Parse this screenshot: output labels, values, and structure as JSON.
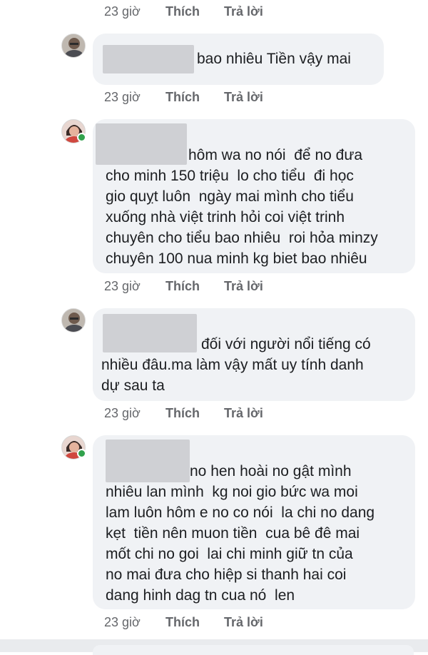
{
  "actions": {
    "time": "23 giờ",
    "like": "Thích",
    "reply": "Trả lời"
  },
  "comments": [
    {
      "avatar": "avatar-woman-glasses",
      "lines": [
        "bao nhiêu Tiền vậy mai"
      ]
    },
    {
      "avatar": "avatar-woman-online",
      "online": true,
      "lines": [
        "hôm wa no nói  để no đưa",
        "cho minh 150 triệu  lo cho tiểu  đi học",
        "gio quỵt luôn  ngày mai mình cho tiểu",
        "xuống nhà việt trinh hỏi coi việt trinh",
        "chuyên cho tiểu bao nhiêu  roi hỏa minzy",
        "chuyên 100 nua minh kg biet bao nhiêu"
      ]
    },
    {
      "avatar": "avatar-woman-glasses",
      "lines": [
        "đối với người nổi tiếng có",
        "nhiều đâu.ma làm vậy mất uy tính danh",
        "dự sau ta"
      ]
    },
    {
      "avatar": "avatar-woman-online",
      "online": true,
      "lines": [
        "no hen hoài no gật mình",
        "nhiêu lan mình  kg noi gio bức wa moi",
        "lam luôn hôm e no co nói  la chi no dang",
        "kẹt  tiền nên muon tiền  cua bê đê mai",
        "mốt chi no goi  lai chi minh giữ tn của",
        "no mai đưa cho hiệp si thanh hai coi",
        "dang hinh dag tn cua nó  len"
      ]
    }
  ]
}
